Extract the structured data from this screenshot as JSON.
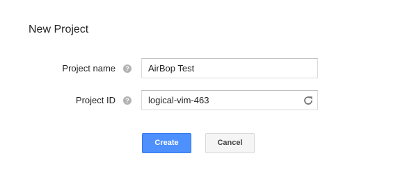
{
  "dialog": {
    "title": "New Project"
  },
  "form": {
    "project_name": {
      "label": "Project name",
      "value": "AirBop Test",
      "help_icon": "question-mark-icon"
    },
    "project_id": {
      "label": "Project ID",
      "value": "logical-vim-463",
      "help_icon": "question-mark-icon",
      "action_icon": "refresh-icon"
    }
  },
  "buttons": {
    "create_label": "Create",
    "cancel_label": "Cancel"
  },
  "colors": {
    "primary_button": "#4d90fe",
    "secondary_button": "#f5f5f5",
    "help_icon": "#b3b3b3"
  }
}
